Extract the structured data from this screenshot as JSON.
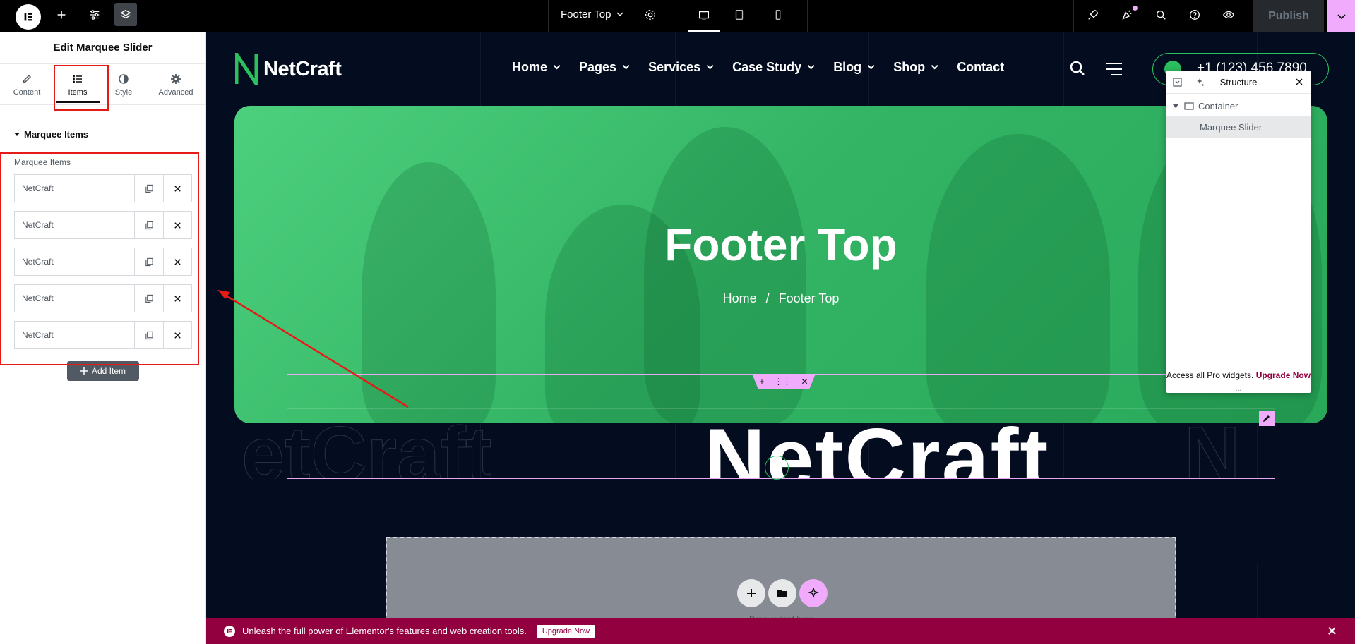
{
  "topbar": {
    "document_title": "Footer Top",
    "publish_label": "Publish"
  },
  "panel": {
    "title": "Edit Marquee Slider",
    "tabs": [
      {
        "label": "Content"
      },
      {
        "label": "Items"
      },
      {
        "label": "Style"
      },
      {
        "label": "Advanced"
      }
    ],
    "section_title": "Marquee Items",
    "repeater_label": "Marquee Items",
    "items": [
      {
        "title": "NetCraft"
      },
      {
        "title": "NetCraft"
      },
      {
        "title": "NetCraft"
      },
      {
        "title": "NetCraft"
      },
      {
        "title": "NetCraft"
      }
    ],
    "add_item_label": "Add Item"
  },
  "site": {
    "logo_text": "NetCraft",
    "nav": [
      {
        "label": "Home"
      },
      {
        "label": "Pages"
      },
      {
        "label": "Services"
      },
      {
        "label": "Case Study"
      },
      {
        "label": "Blog"
      },
      {
        "label": "Shop"
      },
      {
        "label": "Contact"
      }
    ],
    "phone": "+1 (123) 456 7890",
    "hero_title": "Footer Top",
    "breadcrumb_home": "Home",
    "breadcrumb_sep": "/",
    "breadcrumb_current": "Footer Top",
    "marquee_ghost": "etCraft",
    "marquee_text": "NetCraft",
    "marquee_ghost_right": "N",
    "drop_text": "Drag widget here"
  },
  "structure": {
    "title": "Structure",
    "rows": [
      {
        "label": "Container"
      },
      {
        "label": "Marquee Slider"
      }
    ],
    "footer_text": "Access all Pro widgets.",
    "footer_link": "Upgrade Now",
    "more": "..."
  },
  "notice": {
    "text": "Unleash the full power of Elementor's features and web creation tools.",
    "button": "Upgrade Now"
  },
  "colors": {
    "accent_pink": "#f0abfc",
    "brand_green": "#2bbf5e",
    "notice_bg": "#93003f",
    "canvas_bg": "#030d1f"
  }
}
